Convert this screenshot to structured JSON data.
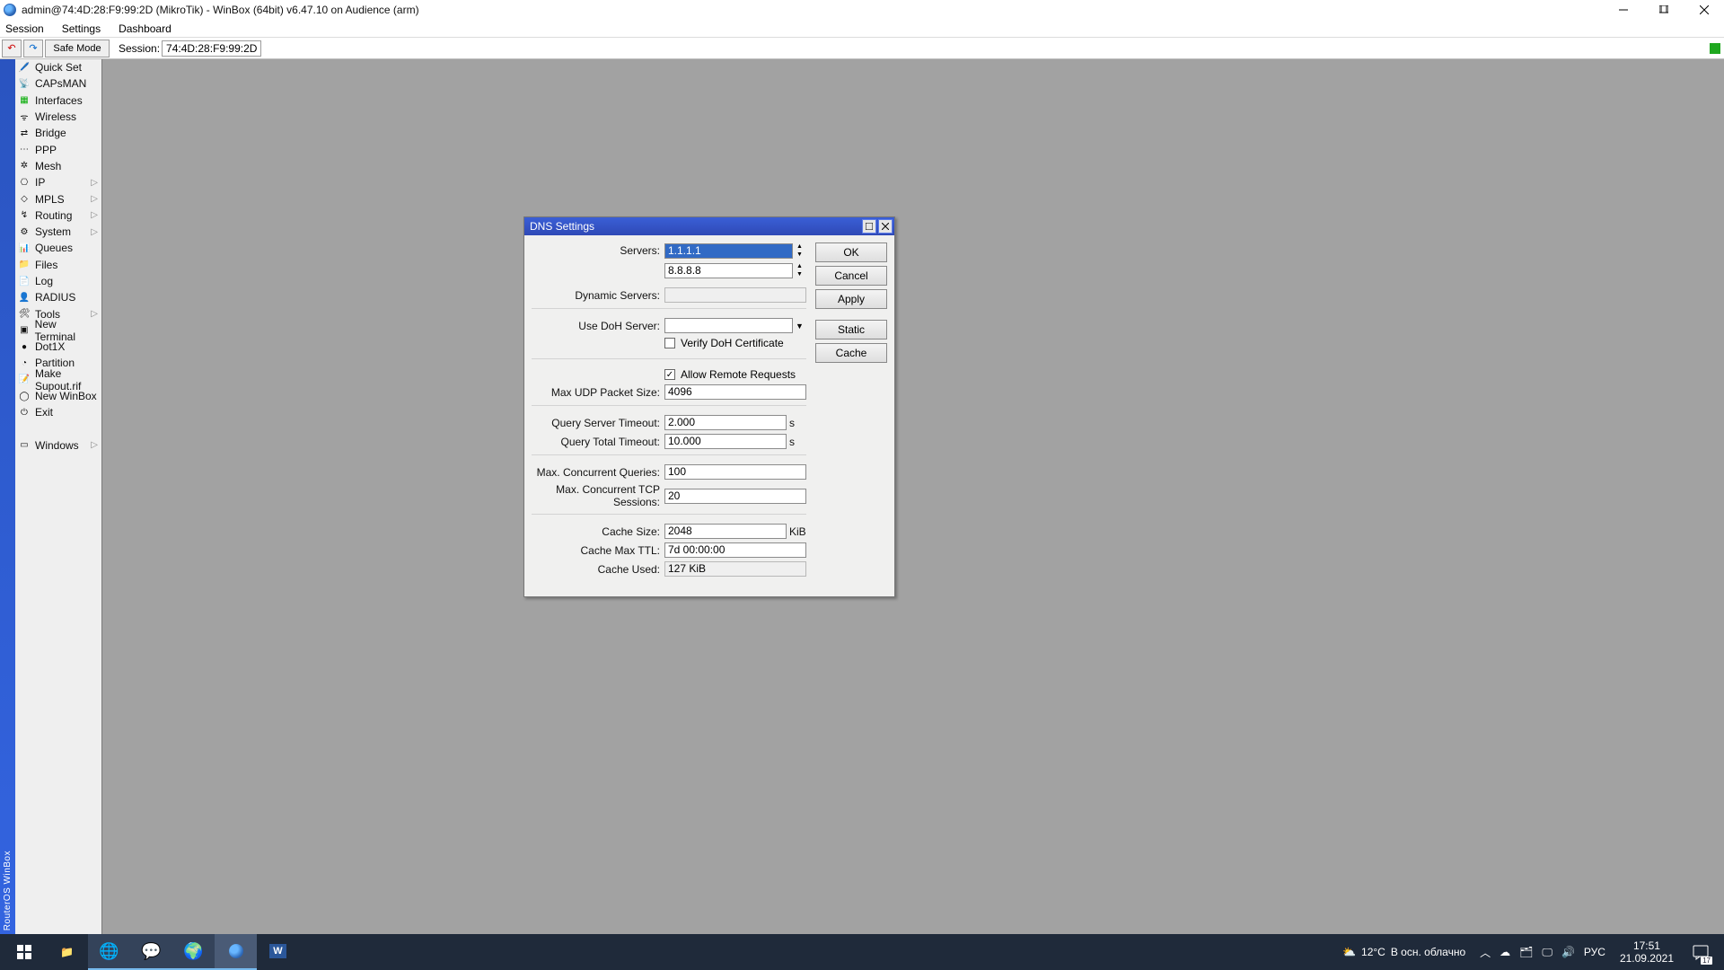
{
  "title": "admin@74:4D:28:F9:99:2D (MikroTik) - WinBox (64bit) v6.47.10 on Audience (arm)",
  "menu": {
    "session": "Session",
    "settings": "Settings",
    "dashboard": "Dashboard"
  },
  "toolbar": {
    "safe_mode": "Safe Mode",
    "session_label": "Session:",
    "session_value": "74:4D:28:F9:99:2D"
  },
  "vertbar": "RouterOS WinBox",
  "sidebar": [
    {
      "icon": "🖊️",
      "label": "Quick Set",
      "sub": false
    },
    {
      "icon": "📡",
      "label": "CAPsMAN",
      "sub": false
    },
    {
      "icon": "▦",
      "label": "Interfaces",
      "sub": false,
      "color": "#0a0"
    },
    {
      "icon": "ᯤ",
      "label": "Wireless",
      "sub": false
    },
    {
      "icon": "⇄",
      "label": "Bridge",
      "sub": false
    },
    {
      "icon": "⋯",
      "label": "PPP",
      "sub": false
    },
    {
      "icon": "✲",
      "label": "Mesh",
      "sub": false
    },
    {
      "icon": "⎔",
      "label": "IP",
      "sub": true
    },
    {
      "icon": "◇",
      "label": "MPLS",
      "sub": true
    },
    {
      "icon": "↯",
      "label": "Routing",
      "sub": true
    },
    {
      "icon": "⚙",
      "label": "System",
      "sub": true
    },
    {
      "icon": "📊",
      "label": "Queues",
      "sub": false
    },
    {
      "icon": "📁",
      "label": "Files",
      "sub": false
    },
    {
      "icon": "📄",
      "label": "Log",
      "sub": false
    },
    {
      "icon": "👤",
      "label": "RADIUS",
      "sub": false
    },
    {
      "icon": "🛠",
      "label": "Tools",
      "sub": true
    },
    {
      "icon": "▣",
      "label": "New Terminal",
      "sub": false
    },
    {
      "icon": "●",
      "label": "Dot1X",
      "sub": false
    },
    {
      "icon": "◔",
      "label": "Partition",
      "sub": false
    },
    {
      "icon": "📝",
      "label": "Make Supout.rif",
      "sub": false
    },
    {
      "icon": "◯",
      "label": "New WinBox",
      "sub": false
    },
    {
      "icon": "⏻",
      "label": "Exit",
      "sub": false
    }
  ],
  "sidebar_windows": {
    "icon": "▭",
    "label": "Windows",
    "sub": true
  },
  "dialog": {
    "title": "DNS Settings",
    "labels": {
      "servers": "Servers:",
      "dynamic_servers": "Dynamic Servers:",
      "use_doh": "Use DoH Server:",
      "verify_doh": "Verify DoH Certificate",
      "allow_remote": "Allow Remote Requests",
      "max_udp": "Max UDP Packet Size:",
      "qst": "Query Server Timeout:",
      "qtt": "Query Total Timeout:",
      "mcq": "Max. Concurrent Queries:",
      "mcts": "Max. Concurrent TCP Sessions:",
      "cache_size": "Cache Size:",
      "cache_ttl": "Cache Max TTL:",
      "cache_used": "Cache Used:",
      "unit_s": "s",
      "unit_kib": "KiB"
    },
    "values": {
      "server1": "1.1.1.1",
      "server2": "8.8.8.8",
      "dynamic_servers": "",
      "use_doh": "",
      "verify_doh": false,
      "allow_remote": true,
      "max_udp": "4096",
      "qst": "2.000",
      "qtt": "10.000",
      "mcq": "100",
      "mcts": "20",
      "cache_size": "2048",
      "cache_ttl": "7d 00:00:00",
      "cache_used": "127 KiB"
    },
    "buttons": {
      "ok": "OK",
      "cancel": "Cancel",
      "apply": "Apply",
      "static": "Static",
      "cache": "Cache"
    }
  },
  "taskbar": {
    "weather_temp": "12°C",
    "weather_text": "В осн. облачно",
    "lang": "РУС",
    "time": "17:51",
    "date": "21.09.2021",
    "notif": "17"
  }
}
